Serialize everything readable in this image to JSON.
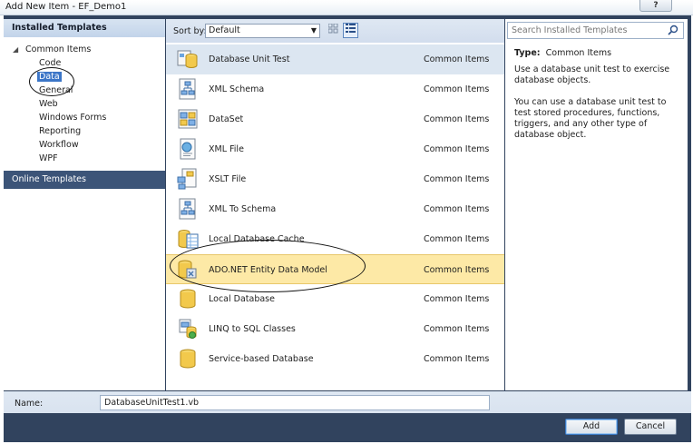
{
  "window": {
    "title": "Add New Item - EF_Demo1"
  },
  "left_panel": {
    "installed_header": "Installed Templates",
    "root": {
      "label": "Common Items",
      "toggle_glyph": "◢"
    },
    "items": [
      {
        "label": "Code"
      },
      {
        "label": "Data",
        "selected": true
      },
      {
        "label": "General"
      },
      {
        "label": "Web"
      },
      {
        "label": "Windows Forms"
      },
      {
        "label": "Reporting"
      },
      {
        "label": "Workflow"
      },
      {
        "label": "WPF"
      }
    ],
    "online_header": "Online Templates"
  },
  "toolbar": {
    "sort_label": "Sort by:",
    "sort_value": "Default"
  },
  "templates": [
    {
      "name": "Database Unit Test",
      "category": "Common Items",
      "icon": "database-unit-test-icon",
      "state": "hover"
    },
    {
      "name": "XML Schema",
      "category": "Common Items",
      "icon": "xml-schema-icon"
    },
    {
      "name": "DataSet",
      "category": "Common Items",
      "icon": "dataset-icon"
    },
    {
      "name": "XML File",
      "category": "Common Items",
      "icon": "xml-file-icon"
    },
    {
      "name": "XSLT File",
      "category": "Common Items",
      "icon": "xslt-file-icon"
    },
    {
      "name": "XML To Schema",
      "category": "Common Items",
      "icon": "xml-to-schema-icon"
    },
    {
      "name": "Local Database Cache",
      "category": "Common Items",
      "icon": "local-database-cache-icon"
    },
    {
      "name": "ADO.NET Entity Data Model",
      "category": "Common Items",
      "icon": "entity-data-model-icon",
      "state": "selected"
    },
    {
      "name": "Local Database",
      "category": "Common Items",
      "icon": "local-database-icon"
    },
    {
      "name": "LINQ to SQL Classes",
      "category": "Common Items",
      "icon": "linq-to-sql-icon"
    },
    {
      "name": "Service-based Database",
      "category": "Common Items",
      "icon": "service-database-icon"
    }
  ],
  "details": {
    "search_placeholder": "Search Installed Templates",
    "type_label": "Type:",
    "type_value": "Common Items",
    "description_1": "Use a database unit test to exercise database objects.",
    "description_2": "You can use a database unit test to test stored procedures, functions, triggers, and any other type of database object."
  },
  "footer": {
    "name_label": "Name:",
    "name_value": "DatabaseUnitTest1.vb",
    "add_label": "Add",
    "cancel_label": "Cancel"
  },
  "colors": {
    "frame": "#31435e",
    "selection_blue": "#3b75c7",
    "selected_row": "#fde9a6",
    "hover_row": "#dce6f1"
  }
}
